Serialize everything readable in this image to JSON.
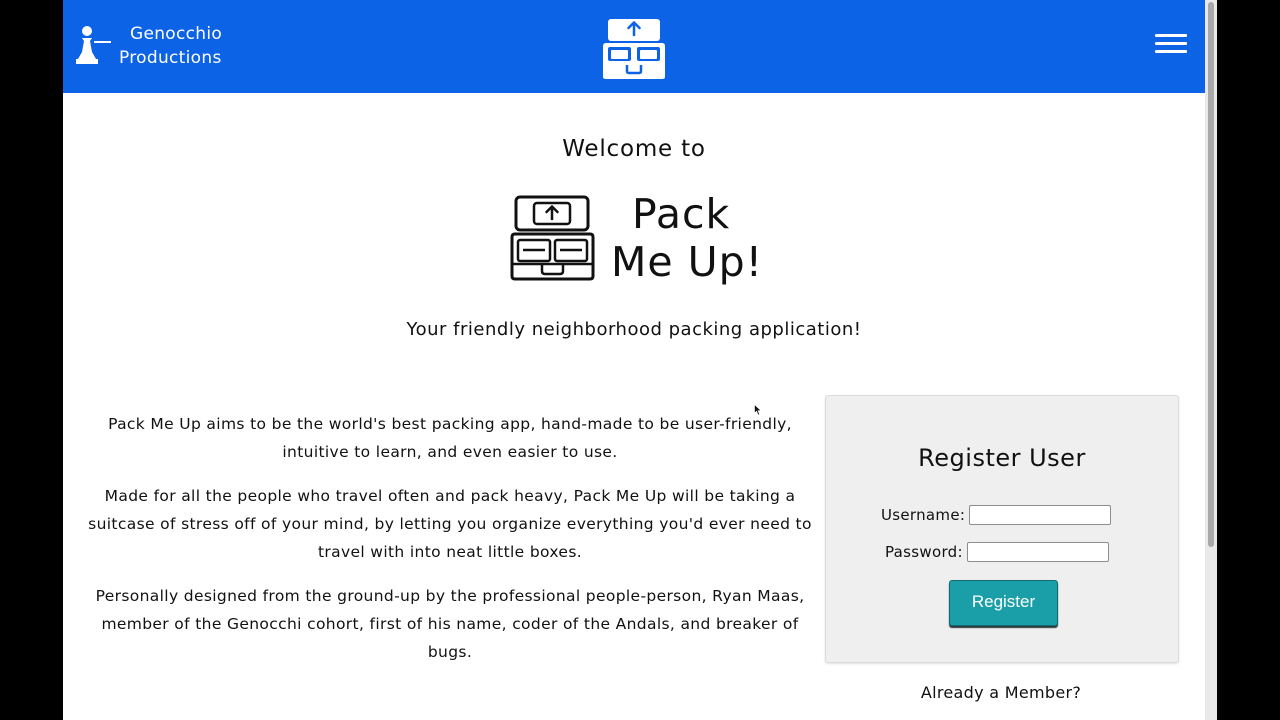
{
  "header": {
    "brand_line1": "Genocchio",
    "brand_line2": "Productions",
    "logo_icon": "packing-box-icon",
    "menu_icon": "hamburger-menu-icon"
  },
  "hero": {
    "welcome": "Welcome to",
    "title_line1": "Pack",
    "title_line2": "Me Up!",
    "tagline": "Your friendly neighborhood packing application!"
  },
  "about": {
    "paragraphs": [
      "Pack Me Up aims to be the world's best packing app, hand-made to be user-friendly, intuitive to learn, and even easier to use.",
      "Made for all the people who travel often and pack heavy, Pack Me Up will be taking a suitcase of stress off of your mind, by letting you organize everything you'd ever need to travel with into neat little boxes.",
      "Personally designed from the ground-up by the professional people-person, Ryan Maas, member of the Genocchi cohort, first of his name, coder of the Andals, and breaker of bugs."
    ]
  },
  "register": {
    "title": "Register User",
    "username_label": "Username:",
    "username_value": "",
    "password_label": "Password:",
    "password_value": "",
    "button_label": "Register",
    "already_member": "Already a Member?"
  },
  "colors": {
    "navbar": "#0d63e6",
    "button": "#1a9fa8",
    "card": "#efefef"
  }
}
